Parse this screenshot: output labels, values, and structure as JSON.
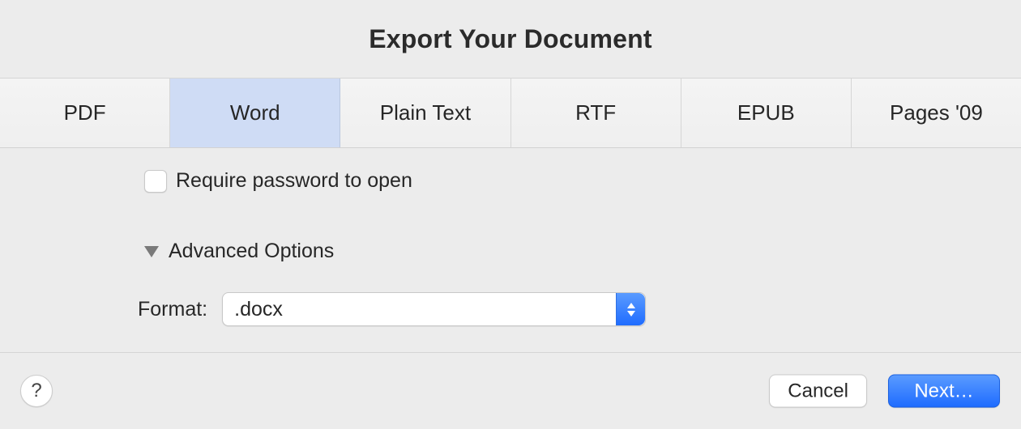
{
  "dialog": {
    "title": "Export Your Document"
  },
  "tabs": [
    {
      "label": "PDF"
    },
    {
      "label": "Word"
    },
    {
      "label": "Plain Text"
    },
    {
      "label": "RTF"
    },
    {
      "label": "EPUB"
    },
    {
      "label": "Pages '09"
    }
  ],
  "selected_tab_index": 1,
  "options": {
    "require_password_label": "Require password to open",
    "require_password_checked": false,
    "advanced_label": "Advanced Options",
    "advanced_expanded": true,
    "format_label": "Format:",
    "format_selected": ".docx"
  },
  "footer": {
    "help_glyph": "?",
    "cancel_label": "Cancel",
    "next_label": "Next…"
  }
}
